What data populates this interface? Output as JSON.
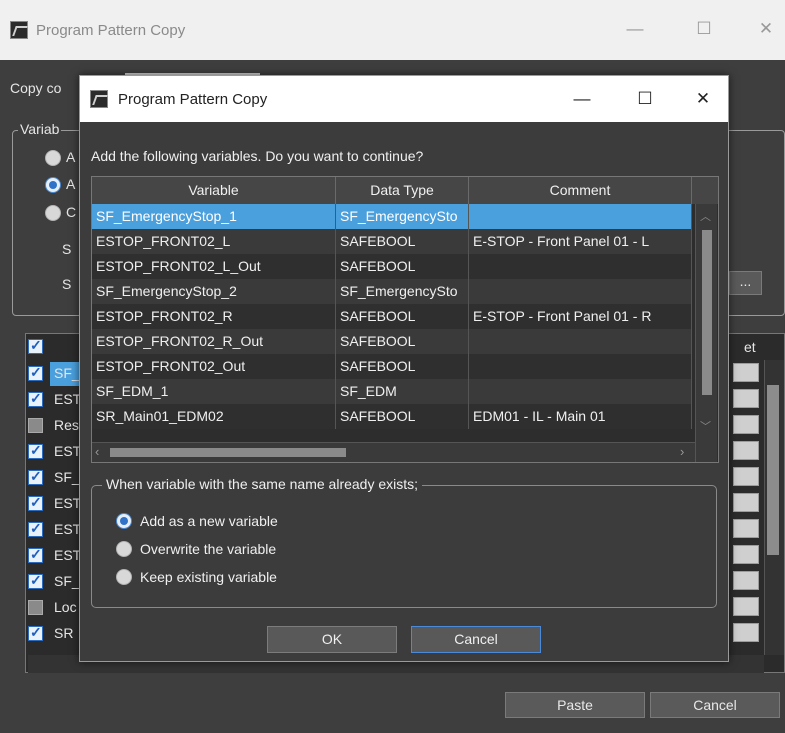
{
  "background": {
    "title": "Program Pattern Copy",
    "window_controls": {
      "minimize": "—",
      "maximize": "☐",
      "close": "✕"
    },
    "copy_label": "Copy co",
    "group_label": "Variab",
    "radio_letters": [
      "A",
      "A",
      "C"
    ],
    "row_labels": [
      "S",
      "S"
    ],
    "browse_label": "...",
    "table": {
      "header_right": "et",
      "rows": [
        {
          "checked": true,
          "text": "SF_"
        },
        {
          "checked": true,
          "text": "EST"
        },
        {
          "checked": false,
          "text": "Res"
        },
        {
          "checked": true,
          "text": "EST"
        },
        {
          "checked": true,
          "text": "SF_"
        },
        {
          "checked": true,
          "text": "EST"
        },
        {
          "checked": true,
          "text": "EST"
        },
        {
          "checked": true,
          "text": "EST"
        },
        {
          "checked": true,
          "text": "SF_"
        },
        {
          "checked": false,
          "text": "Loc"
        },
        {
          "checked": true,
          "text": "SR"
        }
      ]
    },
    "paste_label": "Paste",
    "cancel_label": "Cancel"
  },
  "dialog": {
    "title": "Program Pattern Copy",
    "window_controls": {
      "minimize": "—",
      "maximize": "☐",
      "close": "✕"
    },
    "prompt": "Add the following variables. Do you want to continue?",
    "columns": [
      "Variable",
      "Data Type",
      "Comment"
    ],
    "rows": [
      {
        "variable": "SF_EmergencyStop_1",
        "type": "SF_EmergencySto",
        "comment": "",
        "selected": true
      },
      {
        "variable": "ESTOP_FRONT02_L",
        "type": "SAFEBOOL",
        "comment": "E-STOP - Front Panel 01 - L"
      },
      {
        "variable": "ESTOP_FRONT02_L_Out",
        "type": "SAFEBOOL",
        "comment": ""
      },
      {
        "variable": "SF_EmergencyStop_2",
        "type": "SF_EmergencySto",
        "comment": ""
      },
      {
        "variable": "ESTOP_FRONT02_R",
        "type": "SAFEBOOL",
        "comment": "E-STOP - Front Panel 01 - R"
      },
      {
        "variable": "ESTOP_FRONT02_R_Out",
        "type": "SAFEBOOL",
        "comment": ""
      },
      {
        "variable": "ESTOP_FRONT02_Out",
        "type": "SAFEBOOL",
        "comment": ""
      },
      {
        "variable": "SF_EDM_1",
        "type": "SF_EDM",
        "comment": ""
      },
      {
        "variable": "SR_Main01_EDM02",
        "type": "SAFEBOOL",
        "comment": "EDM01 - IL - Main 01"
      }
    ],
    "group_title": "When variable with the same name already exists;",
    "options": [
      {
        "label": "Add as a new variable",
        "selected": true
      },
      {
        "label": "Overwrite the variable",
        "selected": false
      },
      {
        "label": "Keep existing variable",
        "selected": false
      }
    ],
    "ok_label": "OK",
    "cancel_label": "Cancel"
  },
  "colors": {
    "selection": "#4a9fdd",
    "accent_border": "#4a8ad8",
    "dark_bg": "#3c3c3c"
  }
}
